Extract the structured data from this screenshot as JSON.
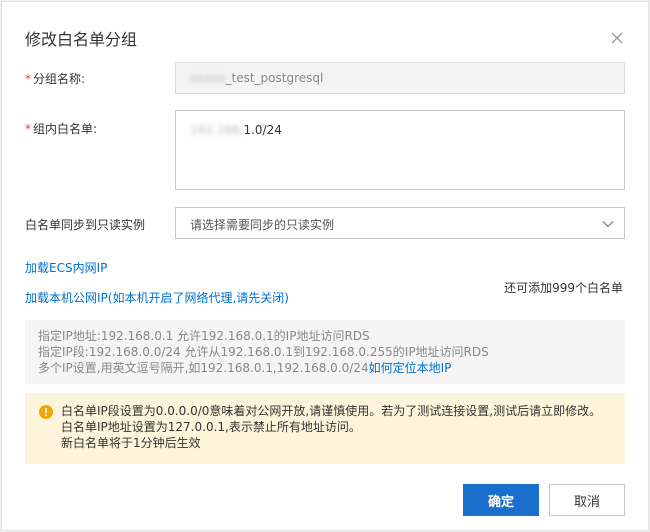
{
  "dialog": {
    "title": "修改白名单分组",
    "close_icon": "close-icon"
  },
  "group_name": {
    "required_mark": "*",
    "label": "分组名称:",
    "value_suffix": "_test_postgresql"
  },
  "whitelist": {
    "required_mark": "*",
    "label": "组内白名单:",
    "value_suffix": "1.0/24"
  },
  "sync_readonly": {
    "label": "白名单同步到只读实例",
    "placeholder": "请选择需要同步的只读实例",
    "dropdown_icon": "chevron-down-icon"
  },
  "links": {
    "load_ecs": "加载ECS内网IP",
    "load_public": "加载本机公网IP(如本机开启了网络代理,请先关闭)"
  },
  "remaining": "还可添加999个白名单",
  "info": {
    "line1": "指定IP地址:192.168.0.1 允许192.168.0.1的IP地址访问RDS",
    "line2": "指定IP段:192.168.0.0/24 允许从192.168.0.1到192.168.0.255的IP地址访问RDS",
    "line3_text": "多个IP设置,用英文逗号隔开,如192.168.0.1,192.168.0.0/24",
    "line3_link": "如何定位本地IP"
  },
  "warning": {
    "icon": "warning-icon",
    "accent": "#f0a70a",
    "line1": "白名单IP段设置为0.0.0.0/0意味着对公网开放,请谨慎使用。若为了测试连接设置,测试后请立即修改。",
    "line2": "白名单IP地址设置为127.0.0.1,表示禁止所有地址访问。",
    "line3": "新白名单将于1分钟后生效"
  },
  "buttons": {
    "ok": "确定",
    "cancel": "取消"
  },
  "colors": {
    "primary": "#1a6ecc",
    "link": "#0070cc",
    "required": "#e8463a"
  }
}
